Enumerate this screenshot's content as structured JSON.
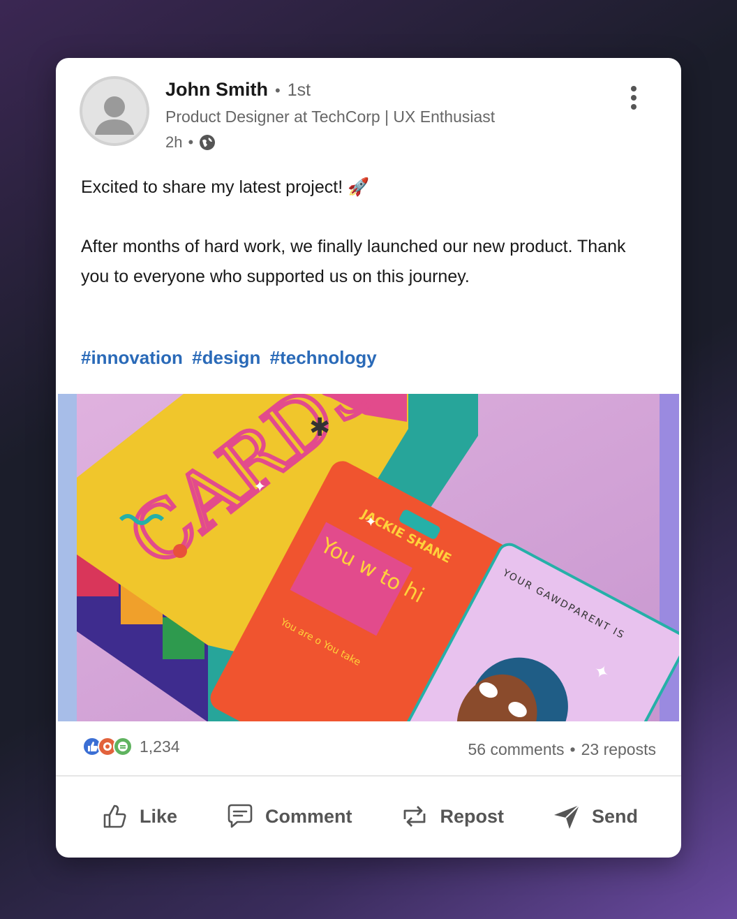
{
  "post": {
    "author": {
      "name": "John Smith",
      "separator": "•",
      "degree": "1st",
      "headline": "Product Designer at TechCorp | UX Enthusiast",
      "time": "2h",
      "visibility_icon": "globe-icon"
    },
    "body": {
      "line1": "Excited to share my latest project! 🚀",
      "line2": "After months of hard work, we finally launched our new product. Thank you to everyone who supported us on this journey."
    },
    "hashtags": [
      "#innovation",
      "#design",
      "#technology"
    ],
    "media": {
      "box_word": "CARDS",
      "card1_name": "JACKIE SHANE",
      "card1_big": "You w to hi",
      "card1_small": "You are o You take",
      "card2_title": "YOUR GAWDPARENT IS"
    }
  },
  "stats": {
    "reaction_icons": [
      "like-icon",
      "celebrate-icon",
      "support-icon"
    ],
    "reaction_count": "1,234",
    "comments": "56 comments",
    "separator": "•",
    "reposts": "23 reposts"
  },
  "actions": {
    "like": "Like",
    "comment": "Comment",
    "repost": "Repost",
    "send": "Send"
  },
  "colors": {
    "accent_link": "#2a6ab8",
    "text_primary": "#191919",
    "text_secondary": "#666666"
  }
}
